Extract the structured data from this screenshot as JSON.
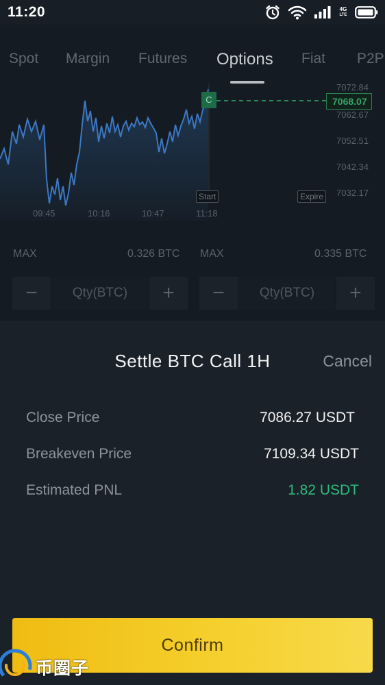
{
  "status_bar": {
    "time": "11:20",
    "network": "4G",
    "network_sub": "LTE"
  },
  "tabs": [
    {
      "label": "Spot",
      "active": false
    },
    {
      "label": "Margin",
      "active": false
    },
    {
      "label": "Futures",
      "active": false
    },
    {
      "label": "Options",
      "active": true
    },
    {
      "label": "Fiat",
      "active": false
    },
    {
      "label": "P2P",
      "active": false
    }
  ],
  "chart": {
    "y_ticks": [
      "7072.84",
      "7062.67",
      "7052.51",
      "7042.34",
      "7032.17"
    ],
    "x_ticks": [
      "09:45",
      "10:16",
      "10:47",
      "11:18"
    ],
    "current_price": "7068.07",
    "call_flag": "C",
    "start_label": "Start",
    "expire_label": "Expire",
    "line_color": "#3d78c4",
    "price_color": "#3aa36b"
  },
  "order_panel": {
    "left": {
      "max_label": "MAX",
      "max_value": "0.326 BTC",
      "qty_placeholder": "Qty(BTC)"
    },
    "right": {
      "max_label": "MAX",
      "max_value": "0.335 BTC",
      "qty_placeholder": "Qty(BTC)"
    },
    "minus_symbol": "−",
    "plus_symbol": "+"
  },
  "sheet": {
    "title": "Settle BTC Call 1H",
    "cancel_label": "Cancel",
    "rows": [
      {
        "label": "Close Price",
        "value": "7086.27 USDT"
      },
      {
        "label": "Breakeven Price",
        "value": "7109.34 USDT"
      },
      {
        "label": "Estimated PNL",
        "value": "1.82 USDT"
      }
    ],
    "confirm_label": "Confirm",
    "accent": "#f0c419",
    "pnl_color": "#2dbb7c"
  },
  "watermark": {
    "text": "币圈子"
  }
}
